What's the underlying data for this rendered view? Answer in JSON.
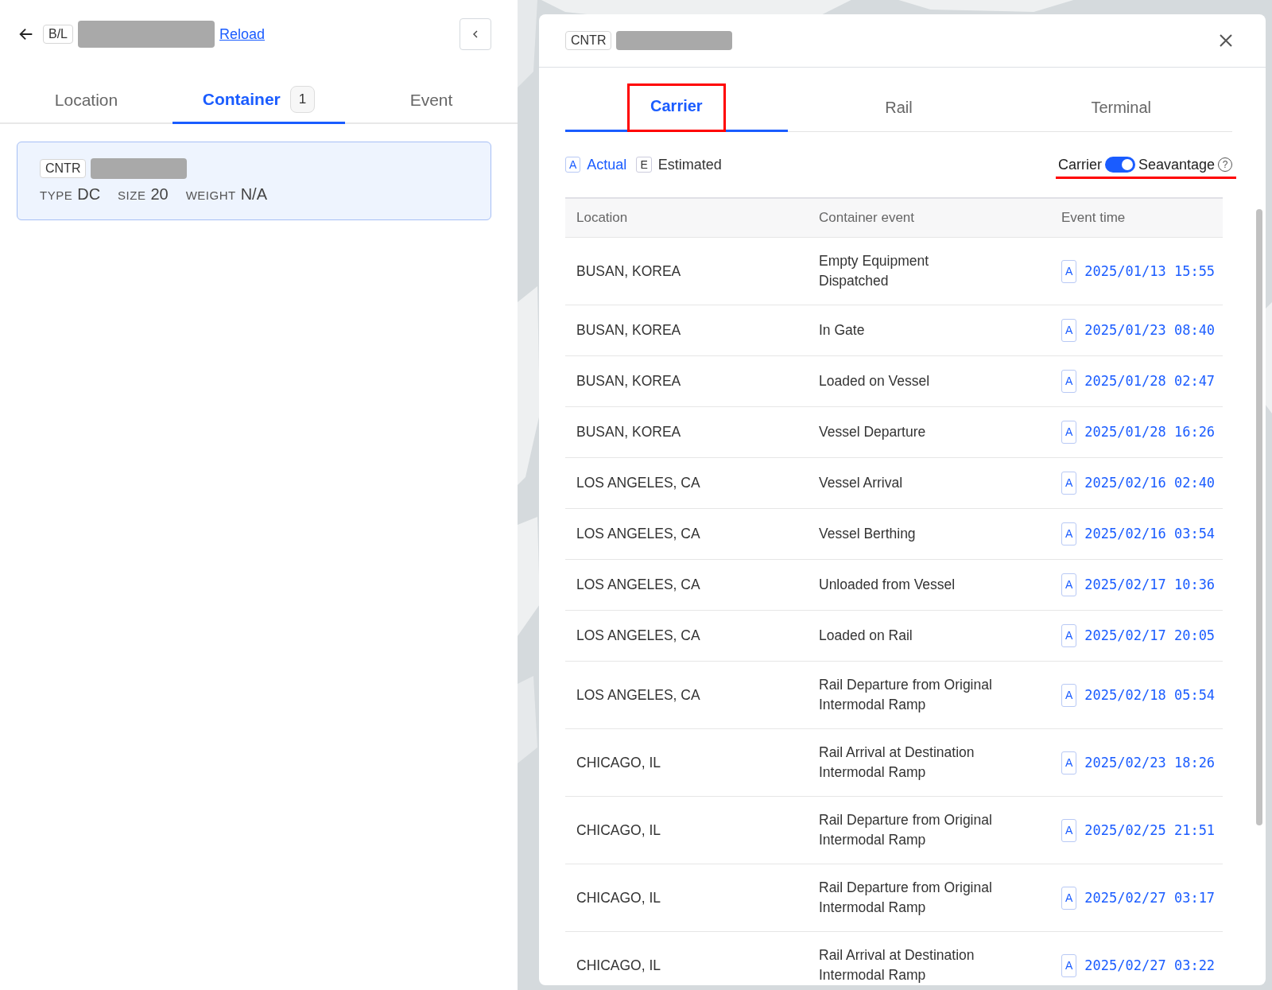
{
  "header": {
    "doc_label": "B/L",
    "reload": "Reload"
  },
  "tabs": [
    {
      "label": "Location",
      "selected": false
    },
    {
      "label": "Container",
      "selected": true,
      "count": "1"
    },
    {
      "label": "Event",
      "selected": false
    }
  ],
  "container_card": {
    "label": "CNTR",
    "selected": true,
    "fields": [
      {
        "key": "TYPE",
        "value": "DC"
      },
      {
        "key": "SIZE",
        "value": "20"
      },
      {
        "key": "WEIGHT",
        "value": "N/A"
      }
    ]
  },
  "modal": {
    "label": "CNTR",
    "tabs": [
      {
        "label": "Carrier",
        "selected": true
      },
      {
        "label": "Rail",
        "selected": false
      },
      {
        "label": "Terminal",
        "selected": false
      }
    ],
    "legend": [
      {
        "mark": "A",
        "label": "Actual",
        "kind": "actual"
      },
      {
        "mark": "E",
        "label": "Estimated",
        "kind": "estimated"
      }
    ],
    "source_toggle": {
      "left": "Carrier",
      "right": "Seavantage",
      "on": true,
      "help": "?"
    },
    "table": {
      "columns": [
        "Location",
        "Container event",
        "Event time"
      ],
      "rows": [
        {
          "location": "BUSAN, KOREA",
          "event": "Empty Equipment Dispatched",
          "mark": "A",
          "time": "2025/01/13 15:55"
        },
        {
          "location": "BUSAN, KOREA",
          "event": "In Gate",
          "mark": "A",
          "time": "2025/01/23 08:40"
        },
        {
          "location": "BUSAN, KOREA",
          "event": "Loaded on Vessel",
          "mark": "A",
          "time": "2025/01/28 02:47"
        },
        {
          "location": "BUSAN, KOREA",
          "event": "Vessel Departure",
          "mark": "A",
          "time": "2025/01/28 16:26"
        },
        {
          "location": "LOS ANGELES, CA",
          "event": "Vessel Arrival",
          "mark": "A",
          "time": "2025/02/16 02:40"
        },
        {
          "location": "LOS ANGELES, CA",
          "event": "Vessel Berthing",
          "mark": "A",
          "time": "2025/02/16 03:54"
        },
        {
          "location": "LOS ANGELES, CA",
          "event": "Unloaded from Vessel",
          "mark": "A",
          "time": "2025/02/17 10:36"
        },
        {
          "location": "LOS ANGELES, CA",
          "event": "Loaded on Rail",
          "mark": "A",
          "time": "2025/02/17 20:05"
        },
        {
          "location": "LOS ANGELES, CA",
          "event": "Rail Departure from Original Intermodal Ramp",
          "mark": "A",
          "time": "2025/02/18 05:54"
        },
        {
          "location": "CHICAGO, IL",
          "event": "Rail Arrival at Destination Intermodal Ramp",
          "mark": "A",
          "time": "2025/02/23 18:26"
        },
        {
          "location": "CHICAGO, IL",
          "event": "Rail Departure from Original Intermodal Ramp",
          "mark": "A",
          "time": "2025/02/25 21:51"
        },
        {
          "location": "CHICAGO, IL",
          "event": "Rail Departure from Original Intermodal Ramp",
          "mark": "A",
          "time": "2025/02/27 03:17"
        },
        {
          "location": "CHICAGO, IL",
          "event": "Rail Arrival at Destination Intermodal Ramp",
          "mark": "A",
          "time": "2025/02/27 03:22"
        }
      ]
    }
  }
}
